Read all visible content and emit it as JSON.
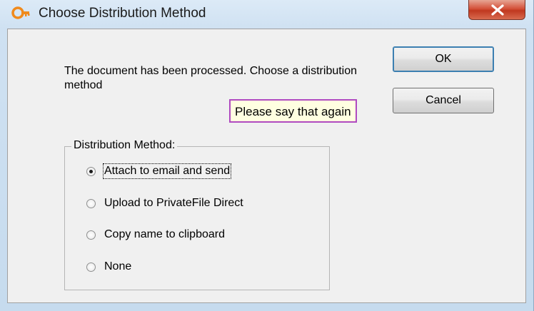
{
  "window": {
    "title": "Choose Distribution Method",
    "icon": "key-icon"
  },
  "message": "The document has been processed. Choose a distribution method",
  "buttons": {
    "ok_label": "OK",
    "cancel_label": "Cancel"
  },
  "tooltip": "Please say that again",
  "group": {
    "label": "Distribution Method:",
    "options": [
      {
        "label": "Attach to email and send",
        "checked": true
      },
      {
        "label": "Upload to PrivateFile Direct",
        "checked": false
      },
      {
        "label": "Copy name to clipboard",
        "checked": false
      },
      {
        "label": "None",
        "checked": false
      }
    ]
  },
  "colors": {
    "tooltip_border": "#b04ac0",
    "tooltip_bg": "#ffffe1",
    "close_button": "#c9452e",
    "icon_accent": "#f08a1c"
  }
}
